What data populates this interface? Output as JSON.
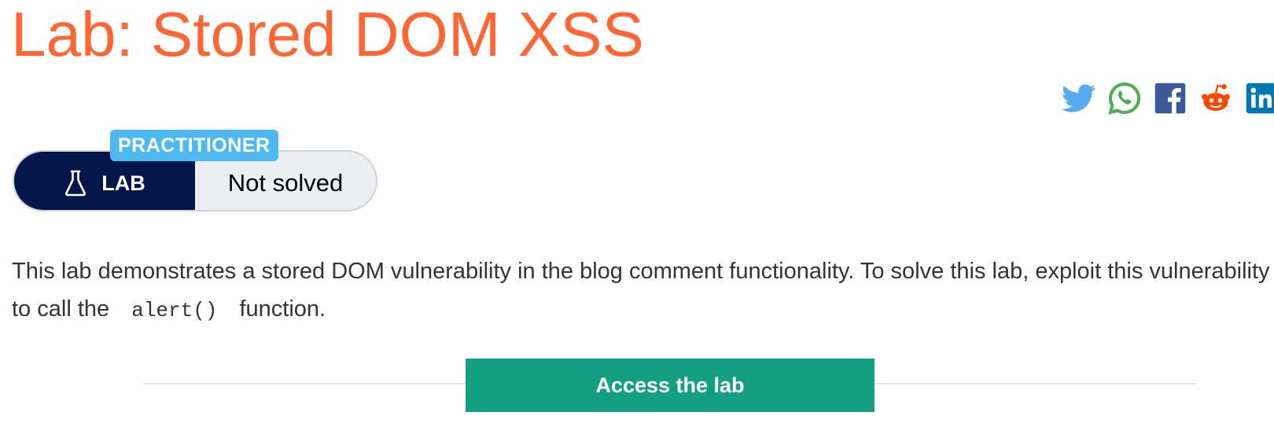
{
  "title": "Lab: Stored DOM XSS",
  "share": [
    {
      "name": "twitter-icon",
      "color": "#55acee"
    },
    {
      "name": "whatsapp-icon",
      "color": "#4caf50"
    },
    {
      "name": "facebook-icon",
      "color": "#3b5998"
    },
    {
      "name": "reddit-icon",
      "color": "#ff4500"
    },
    {
      "name": "linkedin-icon",
      "color": "#0077b5"
    }
  ],
  "lab_status": {
    "level": "PRACTITIONER",
    "lab_label": "LAB",
    "status": "Not solved"
  },
  "description": {
    "before": "This lab demonstrates a stored DOM vulnerability in the blog comment functionality. To solve this lab, exploit this vulnerability to call the",
    "code": "alert()",
    "after": "function."
  },
  "access_button": "Access the lab",
  "colors": {
    "title": "#ff6633",
    "badge": "#4cb9f0",
    "lab_pill": "#05164a",
    "status_pill": "#ebeff2",
    "button": "#159f82"
  }
}
